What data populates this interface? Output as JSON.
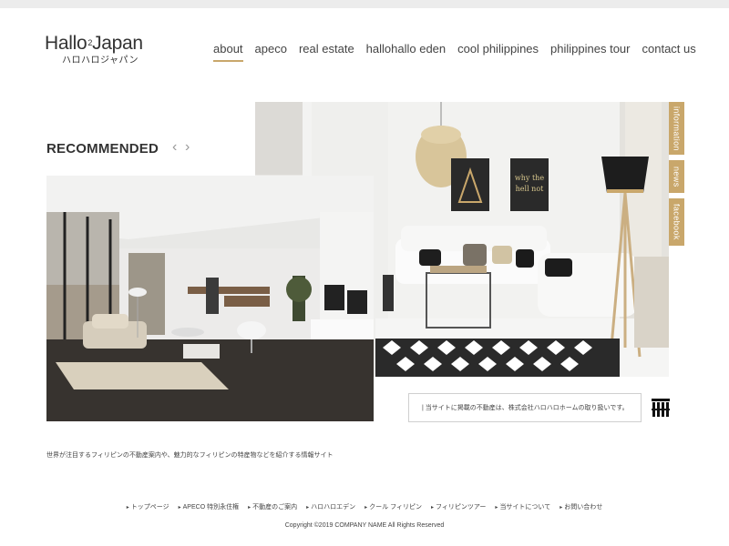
{
  "logo": {
    "main_pre": "Hallo",
    "main_sup": "2",
    "main_post": "Japan",
    "sub": "ハロハロジャパン"
  },
  "nav": {
    "items": [
      {
        "label": "about",
        "active": true
      },
      {
        "label": "apeco"
      },
      {
        "label": "real estate"
      },
      {
        "label": "hallohallo eden"
      },
      {
        "label": "cool philippines"
      },
      {
        "label": "philippines tour"
      },
      {
        "label": "contact us"
      }
    ]
  },
  "recommended": {
    "heading": "RECOMMENDED",
    "prev_icon": "chevron-left-icon",
    "next_icon": "chevron-right-icon"
  },
  "side_tabs": [
    {
      "label": "information"
    },
    {
      "label": "news"
    },
    {
      "label": "facebook"
    }
  ],
  "notice": {
    "text": "| 当サイトに掲載の不動産は、株式会社ハロハロホームの取り扱いです。"
  },
  "tagline": "世界が注目するフィリピンの不動産案内や、魅力的なフィリピンの特産物などを紹介する情報サイト",
  "footer": {
    "links": [
      "トップページ",
      "APECO 特別永住権",
      "不動産のご案内",
      "ハロハロエデン",
      "クール フィリピン",
      "フィリピンツアー",
      "当サイトについて",
      "お問い合わせ"
    ],
    "copyright": "Copyright ©2019 COMPANY NAME All Rights Reserved"
  },
  "colors": {
    "accent": "#c9a76b",
    "text": "#333333",
    "topbar": "#ececec"
  }
}
